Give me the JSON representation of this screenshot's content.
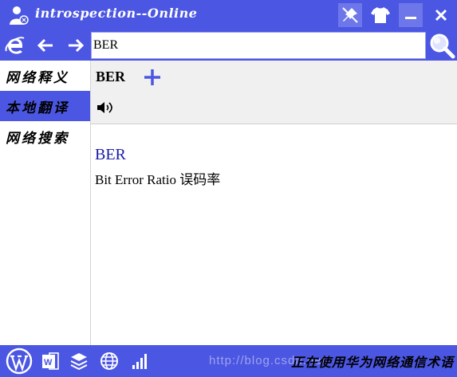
{
  "window": {
    "title": "introspection--Online",
    "icons": [
      "user-icon",
      "pin-off-icon",
      "shirt-icon",
      "minimize-icon",
      "close-icon"
    ]
  },
  "navbar": {
    "icons": [
      "ie-icon",
      "back-arrow-icon",
      "forward-arrow-icon",
      "search-icon"
    ]
  },
  "search": {
    "value": "BER",
    "placeholder": ""
  },
  "sidebar": {
    "items": [
      {
        "label": "网络释义",
        "selected": false
      },
      {
        "label": "本地翻译",
        "selected": true
      },
      {
        "label": "网络搜索",
        "selected": false
      }
    ]
  },
  "header": {
    "word": "BER",
    "icons": [
      "add-icon",
      "speaker-icon"
    ]
  },
  "entry": {
    "word": "BER",
    "definition": "Bit Error Ratio 误码率"
  },
  "statusbar": {
    "icons": [
      "wordpress-icon",
      "word-doc-icon",
      "layers-icon",
      "globe-icon",
      "signal-icon"
    ],
    "text": "正在使用华为网络通信术语",
    "watermark": "http://blog.csdn.net/"
  },
  "colors": {
    "accent": "#4b56e2",
    "panel": "#f0f0f0",
    "entry_word": "#1a1aa6"
  }
}
